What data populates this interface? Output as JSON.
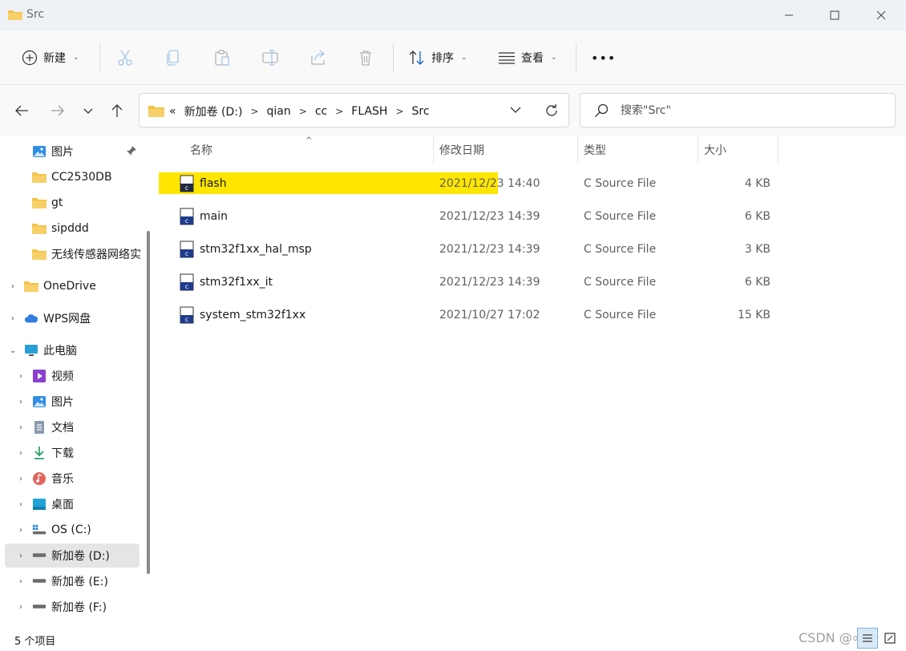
{
  "window": {
    "title": "Src"
  },
  "toolbar": {
    "new_label": "新建",
    "sort_label": "排序",
    "view_label": "查看",
    "more_label": "•••"
  },
  "address": {
    "overflow": "«",
    "crumbs": [
      "新加卷 (D:)",
      "qian",
      "cc",
      "FLASH",
      "Src"
    ]
  },
  "search": {
    "placeholder": "搜索\"Src\""
  },
  "sidebar": {
    "items": [
      {
        "label": "图片",
        "icon": "pictures-icon",
        "pinned": true
      },
      {
        "label": "CC2530DB",
        "icon": "folder-icon"
      },
      {
        "label": "gt",
        "icon": "folder-icon"
      },
      {
        "label": "sipddd",
        "icon": "folder-icon"
      },
      {
        "label": "无线传感器网络实验",
        "icon": "folder-icon"
      },
      {
        "label": "OneDrive",
        "icon": "folder-icon"
      },
      {
        "label": "WPS网盘",
        "icon": "cloud-icon"
      },
      {
        "label": "此电脑",
        "icon": "computer-icon"
      },
      {
        "label": "视频",
        "icon": "video-icon"
      },
      {
        "label": "图片",
        "icon": "pictures-icon"
      },
      {
        "label": "文档",
        "icon": "document-icon"
      },
      {
        "label": "下载",
        "icon": "download-icon"
      },
      {
        "label": "音乐",
        "icon": "music-icon"
      },
      {
        "label": "桌面",
        "icon": "desktop-icon"
      },
      {
        "label": "OS (C:)",
        "icon": "os-drive-icon"
      },
      {
        "label": "新加卷 (D:)",
        "icon": "drive-icon",
        "selected": true
      },
      {
        "label": "新加卷 (E:)",
        "icon": "drive-icon"
      },
      {
        "label": "新加卷 (F:)",
        "icon": "drive-icon"
      }
    ]
  },
  "columns": {
    "name": "名称",
    "modified": "修改日期",
    "type": "类型",
    "size": "大小"
  },
  "files": [
    {
      "name": "flash",
      "modified": "2021/12/23 14:40",
      "type": "C Source File",
      "size": "4 KB",
      "highlighted": true
    },
    {
      "name": "main",
      "modified": "2021/12/23 14:39",
      "type": "C Source File",
      "size": "6 KB"
    },
    {
      "name": "stm32f1xx_hal_msp",
      "modified": "2021/12/23 14:39",
      "type": "C Source File",
      "size": "3 KB"
    },
    {
      "name": "stm32f1xx_it",
      "modified": "2021/12/23 14:39",
      "type": "C Source File",
      "size": "6 KB"
    },
    {
      "name": "system_stm32f1xx",
      "modified": "2021/10/27 17:02",
      "type": "C Source File",
      "size": "15 KB"
    }
  ],
  "status": {
    "count": "5 个项目"
  },
  "watermark": "CSDN @∞29",
  "colors": {
    "folder": "#f4c44a",
    "highlight": "#ffe600",
    "accent": "#0a64c8"
  }
}
